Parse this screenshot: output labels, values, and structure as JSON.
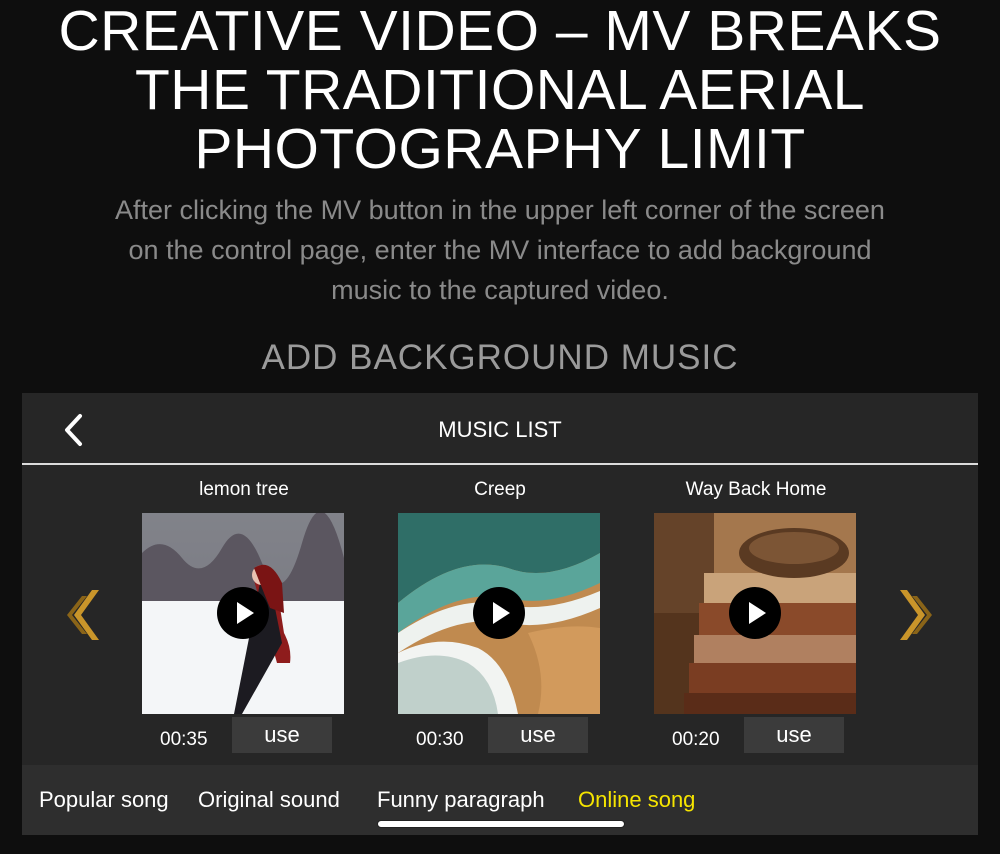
{
  "headline": {
    "lines": [
      "CREATIVE VIDEO – MV BREAKS",
      "THE TRADITIONAL AERIAL",
      "PHOTOGRAPHY LIMIT"
    ]
  },
  "description": {
    "lines": [
      "After clicking the MV button in the upper left corner of the screen",
      "on the control page, enter the MV interface to add background",
      "music to the captured video."
    ]
  },
  "section_title": "ADD BACKGROUND MUSIC",
  "app": {
    "title": "MUSIC LIST",
    "back_icon": "chevron-left-icon",
    "prev_icon": "double-chevron-left-icon",
    "next_icon": "double-chevron-right-icon",
    "accent_color": "#c9952a",
    "songs": [
      {
        "title": "lemon tree",
        "duration": "00:35",
        "use_label": "use",
        "thumbnail": "woman-in-snow"
      },
      {
        "title": "Creep",
        "duration": "00:30",
        "use_label": "use",
        "thumbnail": "ocean-waves-beach"
      },
      {
        "title": "Way Back Home",
        "duration": "00:20",
        "use_label": "use",
        "thumbnail": "books-and-nest"
      }
    ],
    "tabs": [
      {
        "label": "Popular song",
        "active": false
      },
      {
        "label": "Original sound",
        "active": false
      },
      {
        "label": "Funny paragraph",
        "active": true
      },
      {
        "label": "Online song",
        "active": false,
        "color": "#f5e400"
      }
    ]
  }
}
